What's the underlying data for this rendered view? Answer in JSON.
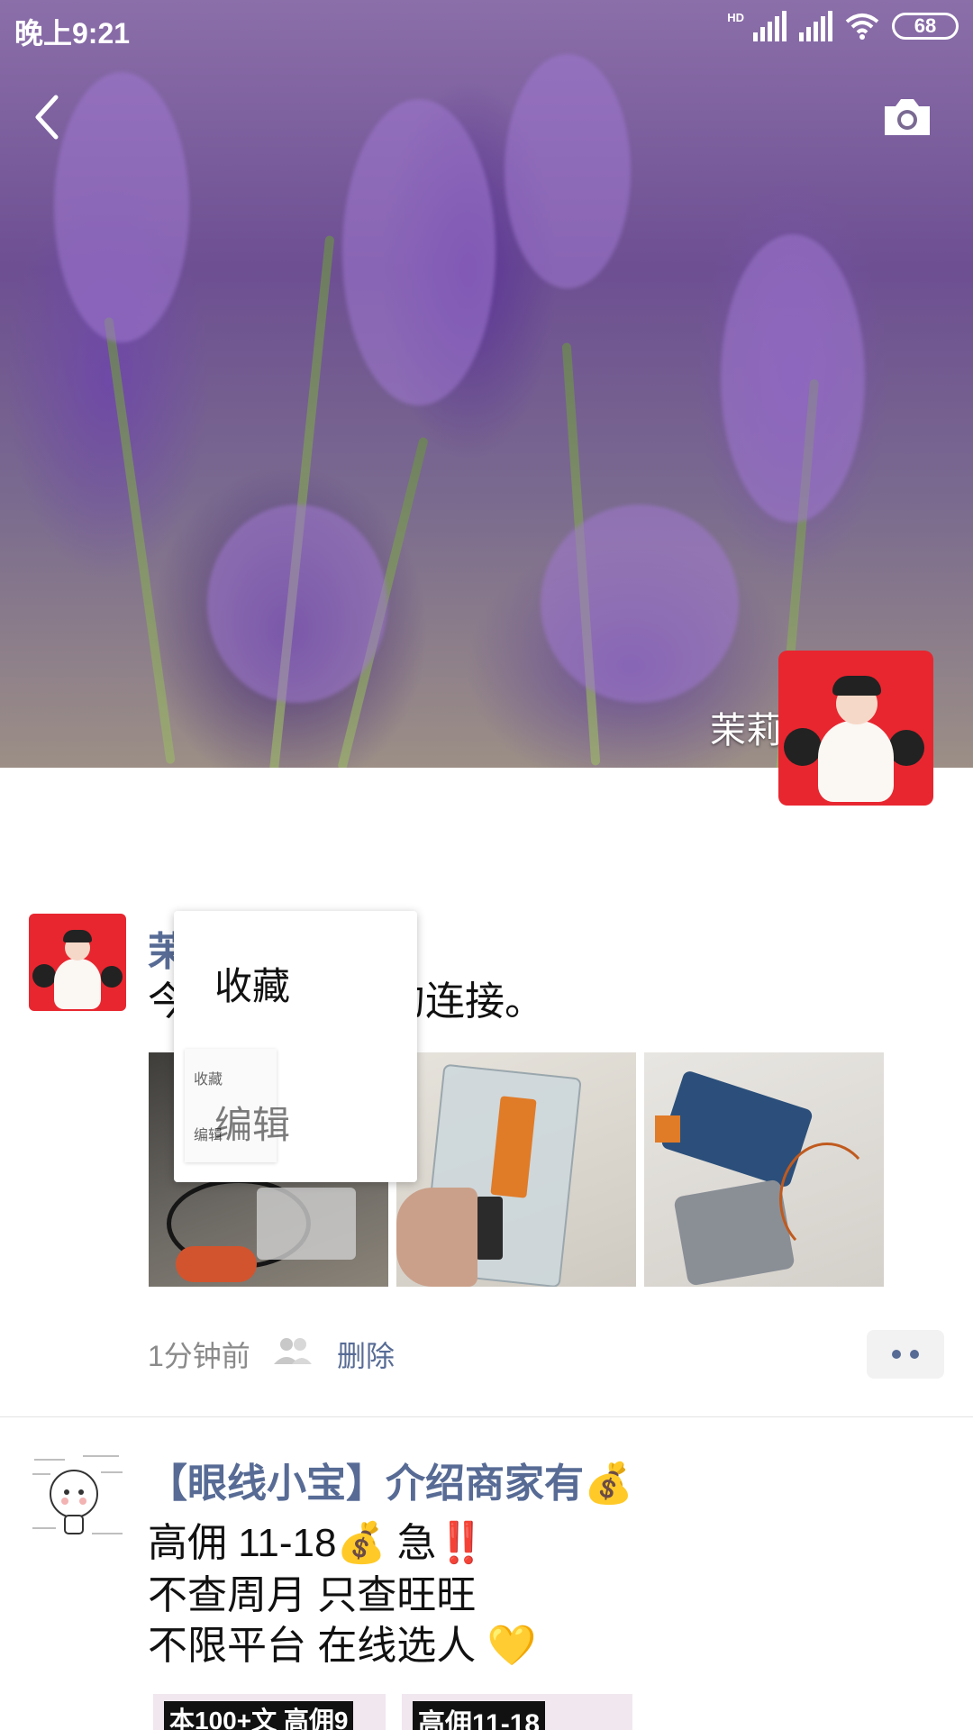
{
  "status_bar": {
    "time": "晚上9:21",
    "network_label": "HD",
    "battery": "68"
  },
  "cover": {
    "user_name": "茉莉"
  },
  "post1": {
    "name": "茉莉",
    "text": "今天学习配件的连接。",
    "time": "1分钟前",
    "delete_label": "删除"
  },
  "context_menu": {
    "items": [
      "收藏",
      "编辑"
    ],
    "ghost_items": [
      "收藏",
      "编辑"
    ]
  },
  "post2": {
    "name": "【眼线小宝】介绍商家有💰",
    "lines": [
      "高佣 11-18💰  急‼️",
      "不查周月 只查旺旺",
      "不限平台   在线选人 💛"
    ],
    "thumb_labels": [
      "本100+文 高佣9",
      "高佣11-18"
    ]
  },
  "colors": {
    "link": "#576b95",
    "background": "#ffffff"
  }
}
